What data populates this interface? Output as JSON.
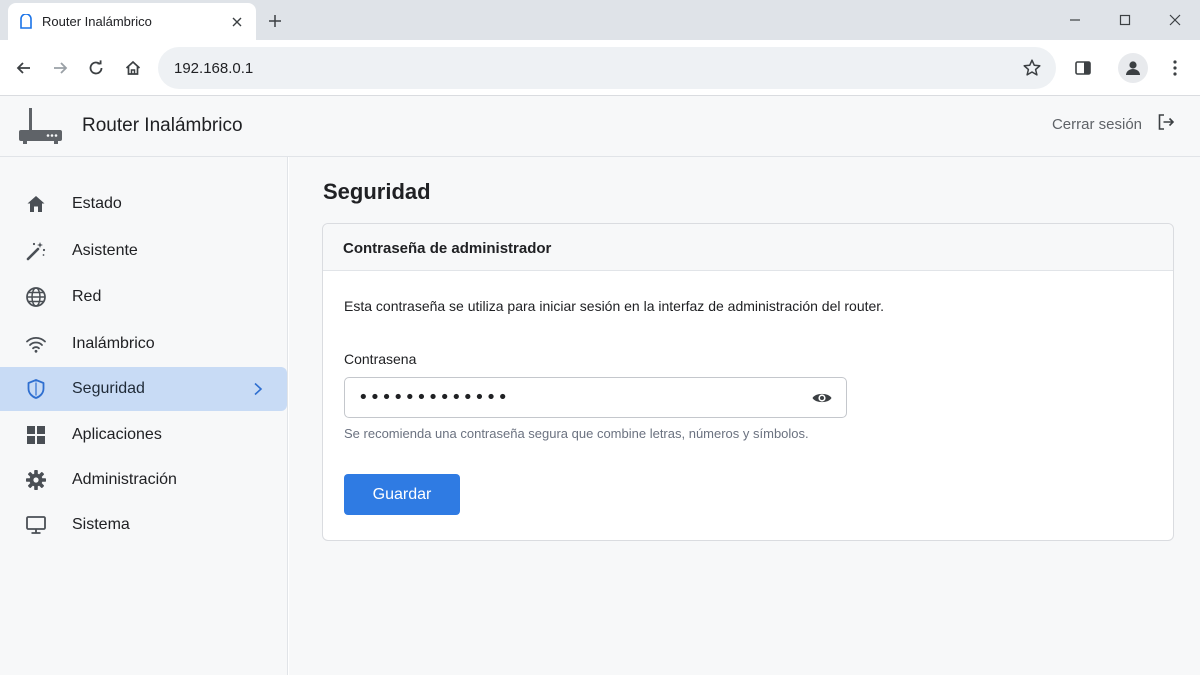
{
  "browser": {
    "tab_title": "Router Inalámbrico",
    "url": "192.168.0.1"
  },
  "app": {
    "title": "Router Inalámbrico",
    "logout_label": "Cerrar sesión"
  },
  "sidebar": {
    "items": [
      {
        "label": "Estado",
        "icon": "home-icon"
      },
      {
        "label": "Asistente",
        "icon": "magic-wand-icon"
      },
      {
        "label": "Red",
        "icon": "globe-icon"
      },
      {
        "label": "Inalámbrico",
        "icon": "wifi-icon"
      },
      {
        "label": "Seguridad",
        "icon": "shield-icon",
        "active": true
      },
      {
        "label": "Aplicaciones",
        "icon": "apps-grid-icon"
      },
      {
        "label": "Administración",
        "icon": "gear-icon"
      },
      {
        "label": "Sistema",
        "icon": "monitor-icon"
      }
    ]
  },
  "main": {
    "page_title": "Seguridad",
    "card": {
      "header": "Contraseña de administrador",
      "description": "Esta contraseña se utiliza para iniciar sesión en la interfaz de administración del router.",
      "password_label": "Contrasena",
      "password_value": "•••••••••••••",
      "hint": "Se recomienda una contraseña segura que combine letras, números y símbolos.",
      "save_label": "Guardar"
    }
  },
  "colors": {
    "accent": "#2f7be3",
    "active_item_bg": "#c8dbf5"
  }
}
